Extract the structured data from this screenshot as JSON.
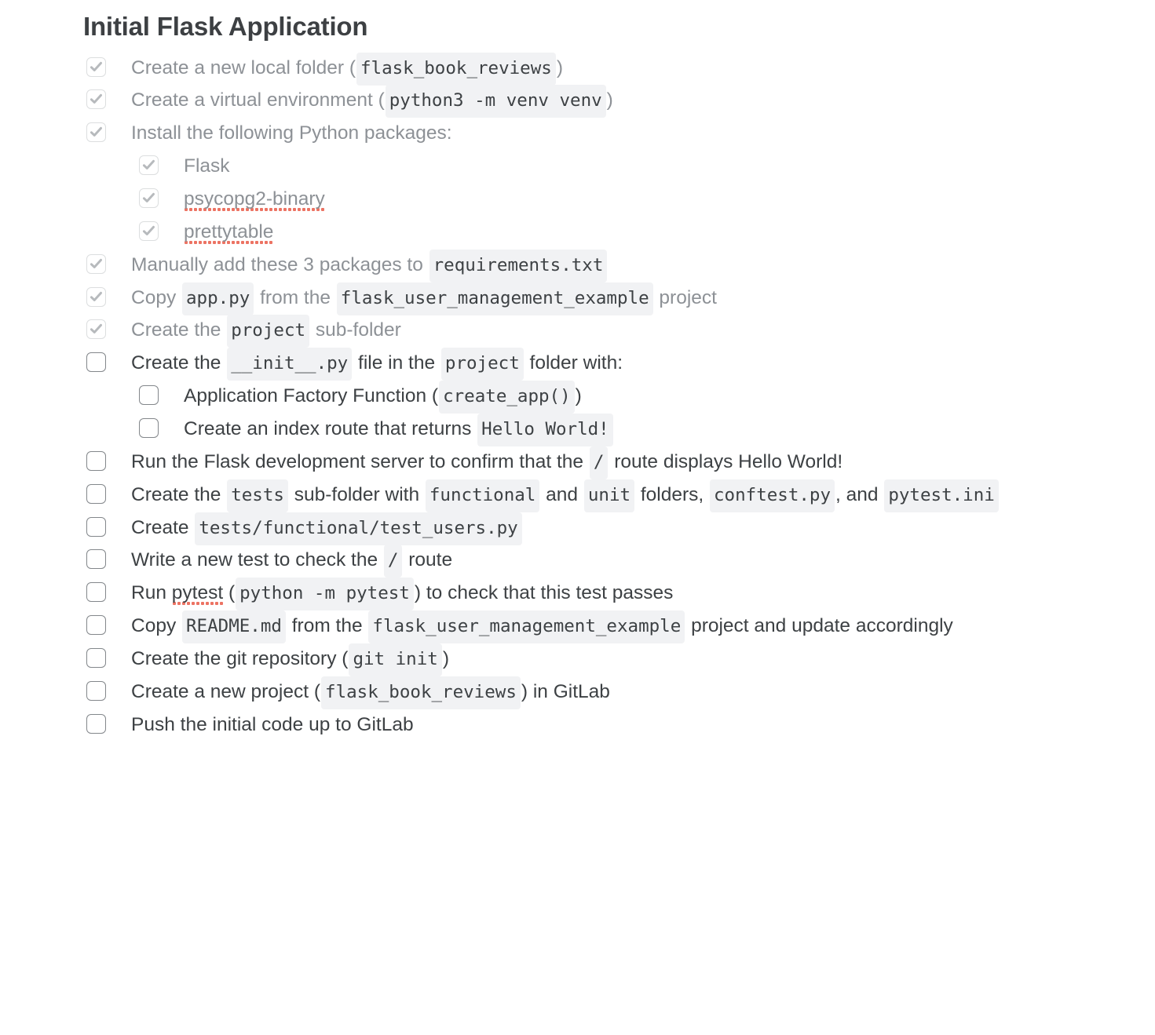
{
  "document": {
    "title": "Initial Flask Application"
  },
  "icons": {
    "checkmark": "check-icon"
  },
  "colors": {
    "title_text": "#3d4043",
    "completed_text": "#8d9196",
    "pending_text": "#3d4144",
    "code_background": "#f1f2f4",
    "checkbox_done_border": "#dcdedf",
    "checkbox_todo_border": "#83878b",
    "spellcheck_underline": "#ec7363",
    "page_background": "#ffffff"
  },
  "tasks": [
    {
      "id": "create-local-folder",
      "checked": true,
      "level": 0,
      "parts": [
        {
          "t": "text",
          "v": "Create a new local folder ("
        },
        {
          "t": "code",
          "v": "flask_book_reviews"
        },
        {
          "t": "text",
          "v": ")"
        }
      ]
    },
    {
      "id": "create-virtual-environment",
      "checked": true,
      "level": 0,
      "parts": [
        {
          "t": "text",
          "v": "Create a virtual environment ("
        },
        {
          "t": "code",
          "v": "python3 -m venv venv"
        },
        {
          "t": "text",
          "v": ")"
        }
      ]
    },
    {
      "id": "install-python-packages",
      "checked": true,
      "level": 0,
      "parts": [
        {
          "t": "text",
          "v": "Install the following Python packages:"
        }
      ]
    },
    {
      "id": "package-flask",
      "checked": true,
      "level": 1,
      "parts": [
        {
          "t": "text",
          "v": "Flask"
        }
      ]
    },
    {
      "id": "package-psycopg2-binary",
      "checked": true,
      "level": 1,
      "parts": [
        {
          "t": "misspell",
          "v": "psycopg2-binary"
        }
      ]
    },
    {
      "id": "package-prettytable",
      "checked": true,
      "level": 1,
      "parts": [
        {
          "t": "misspell",
          "v": "prettytable"
        }
      ]
    },
    {
      "id": "add-packages-to-requirements",
      "checked": true,
      "level": 0,
      "parts": [
        {
          "t": "text",
          "v": "Manually add these 3 packages to "
        },
        {
          "t": "code",
          "v": "requirements.txt"
        }
      ]
    },
    {
      "id": "copy-app-py",
      "checked": true,
      "level": 0,
      "parts": [
        {
          "t": "text",
          "v": "Copy "
        },
        {
          "t": "code",
          "v": "app.py"
        },
        {
          "t": "text",
          "v": " from the "
        },
        {
          "t": "code",
          "v": "flask_user_management_example"
        },
        {
          "t": "text",
          "v": " project"
        }
      ]
    },
    {
      "id": "create-project-subfolder",
      "checked": true,
      "level": 0,
      "parts": [
        {
          "t": "text",
          "v": "Create the "
        },
        {
          "t": "code",
          "v": "project"
        },
        {
          "t": "text",
          "v": " sub-folder"
        }
      ]
    },
    {
      "id": "create-init-file",
      "checked": false,
      "level": 0,
      "parts": [
        {
          "t": "text",
          "v": "Create the "
        },
        {
          "t": "code",
          "v": "__init__.py"
        },
        {
          "t": "text",
          "v": " file in the "
        },
        {
          "t": "code",
          "v": "project"
        },
        {
          "t": "text",
          "v": " folder with:"
        }
      ]
    },
    {
      "id": "application-factory-function",
      "checked": false,
      "level": 1,
      "parts": [
        {
          "t": "text",
          "v": "Application Factory Function ("
        },
        {
          "t": "code",
          "v": "create_app()"
        },
        {
          "t": "text",
          "v": ")"
        }
      ]
    },
    {
      "id": "create-index-route",
      "checked": false,
      "level": 1,
      "parts": [
        {
          "t": "text",
          "v": "Create an index route that returns "
        },
        {
          "t": "code",
          "v": "Hello World!"
        }
      ]
    },
    {
      "id": "run-flask-dev-server",
      "checked": false,
      "level": 0,
      "parts": [
        {
          "t": "text",
          "v": "Run the Flask development server to confirm that the "
        },
        {
          "t": "code",
          "v": "/"
        },
        {
          "t": "text",
          "v": " route displays Hello World!"
        }
      ]
    },
    {
      "id": "create-tests-subfolder",
      "checked": false,
      "level": 0,
      "parts": [
        {
          "t": "text",
          "v": "Create the "
        },
        {
          "t": "code",
          "v": "tests"
        },
        {
          "t": "text",
          "v": " sub-folder with "
        },
        {
          "t": "code",
          "v": "functional"
        },
        {
          "t": "text",
          "v": " and "
        },
        {
          "t": "code",
          "v": "unit"
        },
        {
          "t": "text",
          "v": " folders, "
        },
        {
          "t": "code",
          "v": "conftest.py"
        },
        {
          "t": "text",
          "v": ", and "
        },
        {
          "t": "code",
          "v": "pytest.ini"
        }
      ]
    },
    {
      "id": "create-test-users-file",
      "checked": false,
      "level": 0,
      "parts": [
        {
          "t": "text",
          "v": "Create "
        },
        {
          "t": "code",
          "v": "tests/functional/test_users.py"
        }
      ]
    },
    {
      "id": "write-new-test-root-route",
      "checked": false,
      "level": 0,
      "parts": [
        {
          "t": "text",
          "v": "Write a new test to check the "
        },
        {
          "t": "code",
          "v": "/"
        },
        {
          "t": "text",
          "v": " route"
        }
      ]
    },
    {
      "id": "run-pytest",
      "checked": false,
      "level": 0,
      "parts": [
        {
          "t": "text",
          "v": "Run "
        },
        {
          "t": "misspell",
          "v": "pytest"
        },
        {
          "t": "text",
          "v": " ("
        },
        {
          "t": "code",
          "v": "python -m pytest"
        },
        {
          "t": "text",
          "v": ") to check that this test passes"
        }
      ]
    },
    {
      "id": "copy-readme",
      "checked": false,
      "level": 0,
      "parts": [
        {
          "t": "text",
          "v": "Copy "
        },
        {
          "t": "code",
          "v": "README.md"
        },
        {
          "t": "text",
          "v": " from  the "
        },
        {
          "t": "code",
          "v": "flask_user_management_example"
        },
        {
          "t": "text",
          "v": " project and update accordingly"
        }
      ]
    },
    {
      "id": "create-git-repository",
      "checked": false,
      "level": 0,
      "parts": [
        {
          "t": "text",
          "v": "Create the git repository ("
        },
        {
          "t": "code",
          "v": "git init"
        },
        {
          "t": "text",
          "v": ")"
        }
      ]
    },
    {
      "id": "create-gitlab-project",
      "checked": false,
      "level": 0,
      "parts": [
        {
          "t": "text",
          "v": "Create a new project ("
        },
        {
          "t": "code",
          "v": "flask_book_reviews"
        },
        {
          "t": "text",
          "v": ") in GitLab"
        }
      ]
    },
    {
      "id": "push-initial-code",
      "checked": false,
      "level": 0,
      "parts": [
        {
          "t": "text",
          "v": "Push the initial code up to GitLab"
        }
      ]
    }
  ]
}
